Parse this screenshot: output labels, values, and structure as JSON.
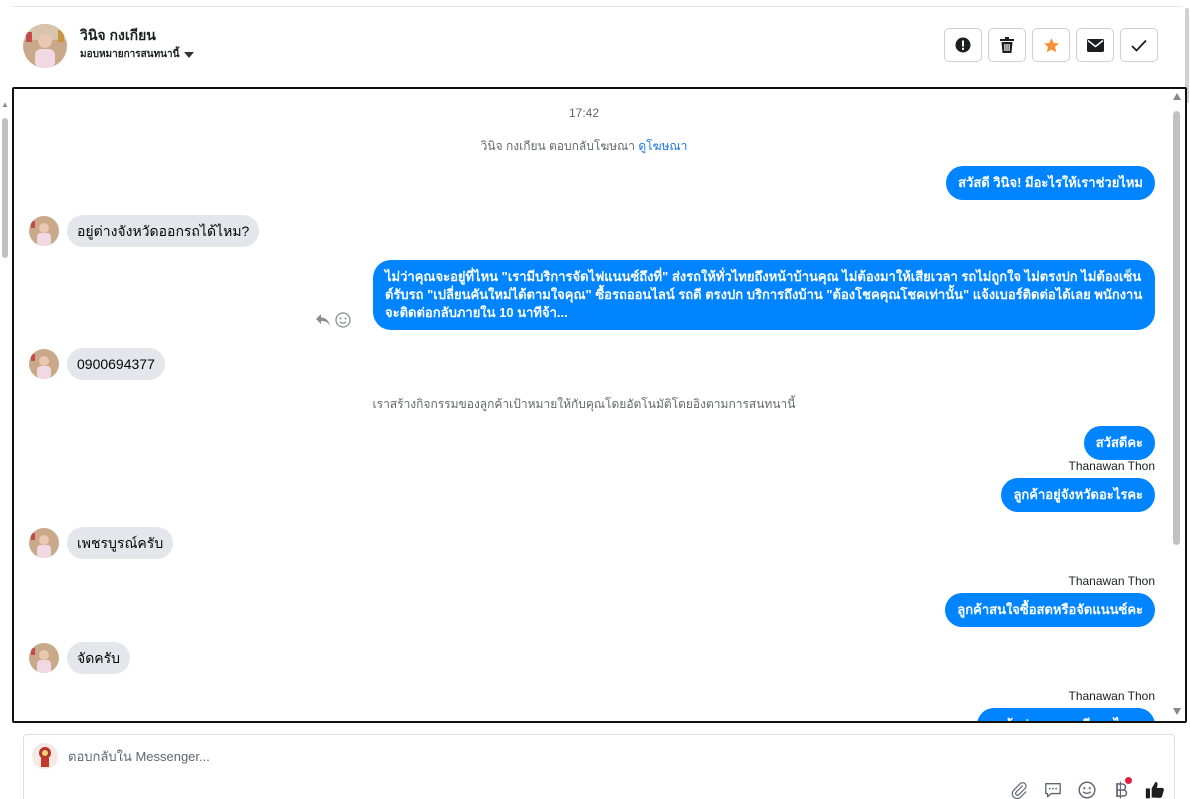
{
  "header": {
    "contact_name": "วินิจ กงเกียน",
    "assign_label": "มอบหมายการสนทนานี้"
  },
  "toolbar": {
    "items": [
      {
        "name": "spam",
        "icon": "exclamation-circle-icon"
      },
      {
        "name": "delete",
        "icon": "trash-icon"
      },
      {
        "name": "star",
        "icon": "star-icon",
        "color": "#f7923a"
      },
      {
        "name": "mark-unread",
        "icon": "envelope-icon"
      },
      {
        "name": "done",
        "icon": "check-icon"
      }
    ]
  },
  "chat": {
    "timestamp": "17:42",
    "ad_reply_text": "วินิจ กงเกียน ตอบกลับโฆษณา",
    "ad_link": "ดูโฆษณา",
    "messages": [
      {
        "dir": "out",
        "text": "สวัสดี วินิจ! มีอะไรให้เราช่วยไหม"
      },
      {
        "dir": "in",
        "text": "อยู่ต่างจังหวัดออกรถได้ไหม?"
      },
      {
        "dir": "out",
        "text": "ไม่ว่าคุณจะอยู่ที่ไหน \"เรามีบริการจัดไฟแนนซ์ถึงที่\"  ส่งรถให้ทั่วไทยถึงหน้าบ้านคุณ ไม่ต้องมาให้เสียเวลา รถไม่ถูกใจ ไม่ตรงปก ไม่ต้องเซ็นต์รับรถ \"เปลี่ยนคันใหม่ได้ตามใจคุณ\" ซื้อรถออนไลน์ รถดี ตรงปก บริการถึงบ้าน \"ต้องโชคคุณโชคเท่านั้น\" แจ้งเบอร์ติดต่อได้เลย พนักงานจะติดต่อกลับภายใน 10 นาทีจ้า..."
      },
      {
        "dir": "in",
        "text": "0900694377"
      },
      {
        "dir": "out",
        "text": "สวัสดีคะ"
      },
      {
        "dir": "out",
        "text": "ลูกค้าอยู่จังหวัดอะไรคะ"
      },
      {
        "dir": "in",
        "text": "เพชรบูรณ์ครับ"
      },
      {
        "dir": "out",
        "text": "ลูกค้าสนใจซื้อสดหรือจัดแนนซ์คะ"
      },
      {
        "dir": "in",
        "text": "จัดครับ"
      },
      {
        "dir": "out",
        "text": "ลูกค้าประกอบอาชีพอะไรคะ"
      }
    ],
    "activity_note": "เราสร้างกิจกรรมของลูกค้าเป้าหมายให้กับคุณโดยอัตโนมัติโดยอิงตามการสนทนานี้",
    "agent_name": "Thanawan Thon"
  },
  "composer": {
    "placeholder": "ตอบกลับใน Messenger...",
    "tools": [
      "paperclip-icon",
      "saved-reply-icon",
      "emoji-icon",
      "baht-icon",
      "thumbs-up-icon"
    ],
    "accent_color": "#0084ff"
  }
}
